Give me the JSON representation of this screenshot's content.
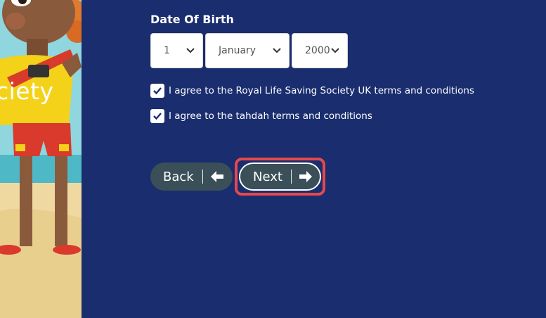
{
  "sidebar": {
    "banner_text": "ciety"
  },
  "form": {
    "dob_label": "Date Of Birth",
    "day": {
      "value": "1"
    },
    "month": {
      "value": "January"
    },
    "year": {
      "value": "2000"
    },
    "terms1": {
      "label": "I agree to the Royal Life Saving Society UK terms and conditions",
      "checked": true
    },
    "terms2": {
      "label": "I agree to the tahdah terms and conditions",
      "checked": true
    }
  },
  "buttons": {
    "back_label": "Back",
    "next_label": "Next"
  },
  "colors": {
    "page_bg": "#1a2d6e",
    "button_bg": "#3a4f57",
    "highlight": "#e5484d"
  },
  "icons": {
    "back": "arrow-left-icon",
    "next": "arrow-right-icon",
    "select": "chevron-down-icon",
    "check": "check-icon"
  }
}
